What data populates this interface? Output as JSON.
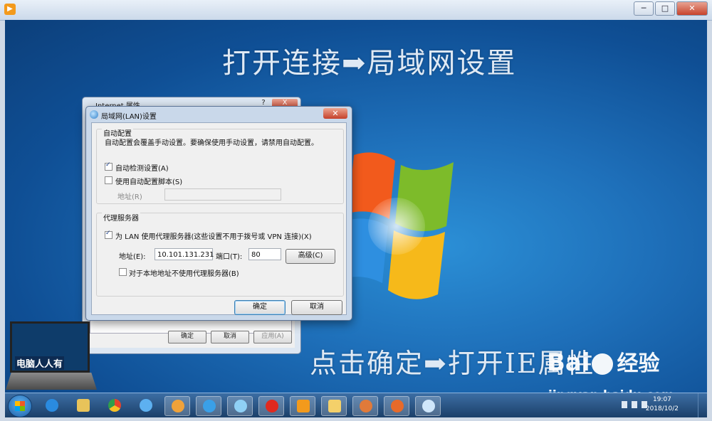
{
  "window": {
    "close_glyph": "✕",
    "min_glyph": "─",
    "max_glyph": "□"
  },
  "desktop": {
    "caption_top": "打开连接➡局域网设置",
    "caption_bottom": "点击确定➡打开IE属性"
  },
  "inet_window": {
    "title": "Internet 属性",
    "help": "?",
    "close": "X",
    "ok": "确定",
    "cancel": "取消",
    "apply": "应用(A)"
  },
  "lan_dialog": {
    "title": "局域网(LAN)设置",
    "close": "✕",
    "auto_config": {
      "heading": "自动配置",
      "description": "自动配置会覆盖手动设置。要确保使用手动设置，请禁用自动配置。",
      "auto_detect_label": "自动检测设置(A)",
      "auto_detect_checked": true,
      "use_script_label": "使用自动配置脚本(S)",
      "use_script_checked": false,
      "address_label": "地址(R)",
      "address_value": ""
    },
    "proxy": {
      "heading": "代理服务器",
      "use_proxy_label": "为 LAN 使用代理服务器(这些设置不用于拨号或 VPN 连接)(X)",
      "use_proxy_checked": true,
      "address_label": "地址(E):",
      "address_value": "10.101.131.231",
      "port_label": "端口(T):",
      "port_value": "80",
      "advanced_button": "高级(C)",
      "bypass_label": "对于本地地址不使用代理服务器(B)",
      "bypass_checked": false
    },
    "ok_button": "确定",
    "cancel_button": "取消"
  },
  "logo": {
    "text": "电脑人人有"
  },
  "watermark": {
    "brand": "Bai",
    "brand2": "经验",
    "url": "jingyan.baidu.com"
  },
  "taskbar": {
    "time": "19:07",
    "date": "2018/10/2",
    "icons": [
      "start-button",
      "ie-icon",
      "file-explorer-icon",
      "chrome-icon",
      "network-icon",
      "paint-icon",
      "browser-icon",
      "pinwheel-icon",
      "chess-icon",
      "media-player-icon",
      "folder-icon",
      "monkey-icon",
      "paint2-icon",
      "internet-settings-icon"
    ],
    "colors": {
      "ie": "#2a8be0",
      "chrome": "#e4442c",
      "chess": "#e0291f",
      "player": "#f39a1c"
    }
  }
}
